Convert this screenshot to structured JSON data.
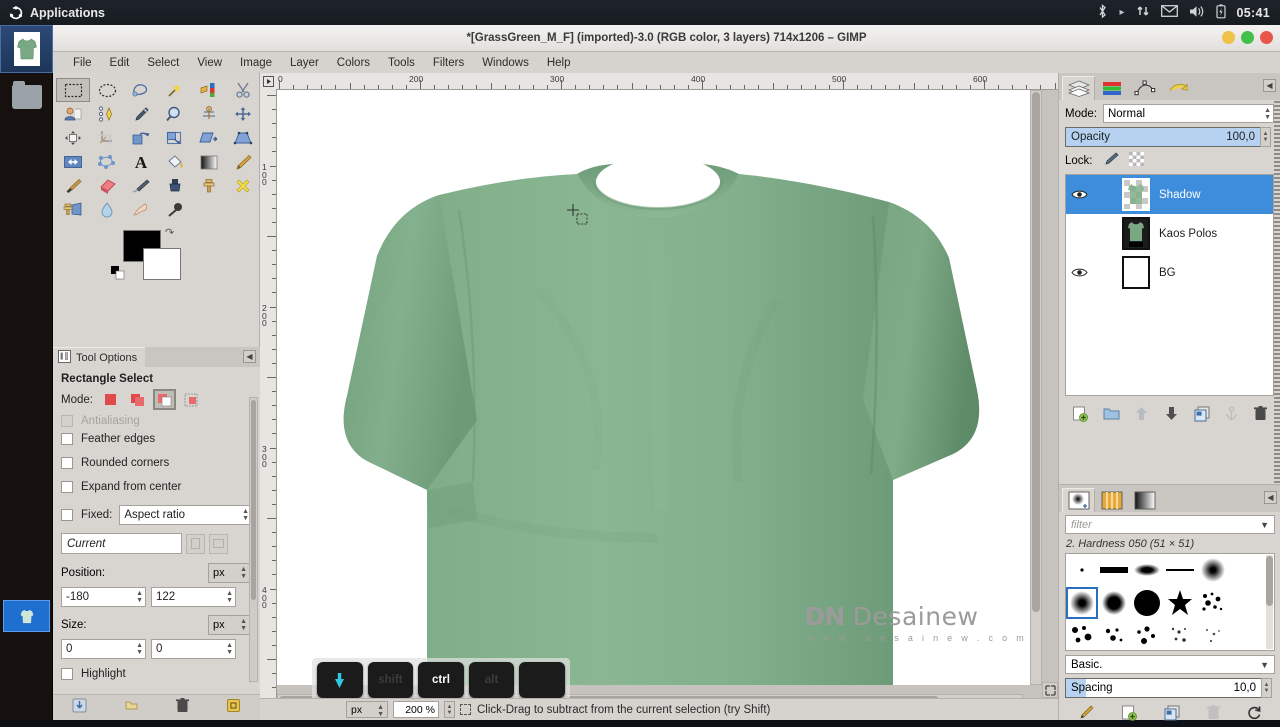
{
  "systembar": {
    "applications_label": "Applications",
    "logo_icon": "ubuntu-logo-icon",
    "tray": [
      {
        "name": "bluetooth-icon",
        "glyph": "ᛦ"
      },
      {
        "name": "dropbox-sync-icon",
        "glyph": "▸"
      },
      {
        "name": "network-updown-icon",
        "glyph": "⇅"
      },
      {
        "name": "mail-icon",
        "glyph": "✉"
      },
      {
        "name": "volume-icon",
        "glyph": "🔊"
      },
      {
        "name": "battery-icon",
        "glyph": "▯"
      }
    ],
    "clock": "05:41"
  },
  "launcher": {
    "items": [
      {
        "name": "launcher-gimp-item",
        "icon": "gimp-shirt-thumbnail",
        "selected": true
      },
      {
        "name": "launcher-files-item",
        "icon": "folder-icon",
        "selected": false
      }
    ],
    "taskbar_item": {
      "name": "launcher-window-preview",
      "icon": "shirt-window-preview"
    }
  },
  "window": {
    "title": "*[GrassGreen_M_F] (imported)-3.0 (RGB color, 3 layers) 714x1206 – GIMP",
    "buttons": [
      {
        "name": "minimize-button",
        "color": "#f0c24a"
      },
      {
        "name": "maximize-button",
        "color": "#43c04a"
      },
      {
        "name": "close-button",
        "color": "#e8554b"
      }
    ]
  },
  "menubar": {
    "items": [
      "File",
      "Edit",
      "Select",
      "View",
      "Image",
      "Layer",
      "Colors",
      "Tools",
      "Filters",
      "Windows",
      "Help"
    ]
  },
  "toolbox": {
    "tools": [
      {
        "name": "rectangle-select-tool",
        "selected": true
      },
      {
        "name": "ellipse-select-tool",
        "selected": false
      },
      {
        "name": "free-select-tool",
        "selected": false
      },
      {
        "name": "fuzzy-select-tool",
        "selected": false
      },
      {
        "name": "select-by-color-tool",
        "selected": false
      },
      {
        "name": "scissors-select-tool",
        "selected": false
      },
      {
        "name": "foreground-select-tool",
        "selected": false
      },
      {
        "name": "paths-tool",
        "selected": false
      },
      {
        "name": "color-picker-tool",
        "selected": false
      },
      {
        "name": "zoom-tool",
        "selected": false
      },
      {
        "name": "measure-tool",
        "selected": false
      },
      {
        "name": "move-tool",
        "selected": false
      },
      {
        "name": "align-tool",
        "selected": false
      },
      {
        "name": "crop-tool",
        "selected": false
      },
      {
        "name": "rotate-tool",
        "selected": false
      },
      {
        "name": "scale-tool",
        "selected": false
      },
      {
        "name": "shear-tool",
        "selected": false
      },
      {
        "name": "perspective-tool",
        "selected": false
      },
      {
        "name": "flip-tool",
        "selected": false
      },
      {
        "name": "cage-transform-tool",
        "selected": false
      },
      {
        "name": "text-tool",
        "selected": false
      },
      {
        "name": "bucket-fill-tool",
        "selected": false
      },
      {
        "name": "gradient-tool",
        "selected": false
      },
      {
        "name": "pencil-tool",
        "selected": false
      },
      {
        "name": "paintbrush-tool",
        "selected": false
      },
      {
        "name": "eraser-tool",
        "selected": false
      },
      {
        "name": "airbrush-tool",
        "selected": false
      },
      {
        "name": "ink-tool",
        "selected": false
      },
      {
        "name": "clone-tool",
        "selected": false
      },
      {
        "name": "heal-tool",
        "selected": false
      },
      {
        "name": "perspective-clone-tool",
        "selected": false
      },
      {
        "name": "blur-sharpen-tool",
        "selected": false
      },
      {
        "name": "smudge-tool",
        "selected": false
      },
      {
        "name": "dodge-burn-tool",
        "selected": false
      }
    ],
    "foreground_color": "#000000",
    "background_color": "#ffffff"
  },
  "tool_options": {
    "tab_label": "Tool Options",
    "title": "Rectangle Select",
    "mode_label": "Mode:",
    "modes": [
      {
        "name": "mode-replace",
        "selected": false
      },
      {
        "name": "mode-add",
        "selected": false
      },
      {
        "name": "mode-subtract",
        "selected": true
      },
      {
        "name": "mode-intersect",
        "selected": false
      }
    ],
    "checks": [
      {
        "label": "Antialiasing",
        "checked": true,
        "disabled": true,
        "name": "antialiasing-checkbox"
      },
      {
        "label": "Feather edges",
        "checked": false,
        "disabled": false,
        "name": "feather-edges-checkbox"
      },
      {
        "label": "Rounded corners",
        "checked": false,
        "disabled": false,
        "name": "rounded-corners-checkbox"
      },
      {
        "label": "Expand from center",
        "checked": false,
        "disabled": false,
        "name": "expand-from-center-checkbox"
      }
    ],
    "fixed_label": "Fixed:",
    "fixed_value": "Aspect ratio",
    "aspect_value": "Current",
    "position_label": "Position:",
    "position_unit": "px",
    "position_x": "-180",
    "position_y": "122",
    "size_label": "Size:",
    "size_unit": "px",
    "size_w": "0",
    "size_h": "0",
    "highlight_label": "Highlight",
    "highlight_checked": false,
    "bottom_buttons": [
      {
        "name": "save-tool-preset-button"
      },
      {
        "name": "restore-tool-preset-button"
      },
      {
        "name": "delete-tool-preset-button"
      },
      {
        "name": "reset-tool-options-button"
      }
    ]
  },
  "canvas": {
    "ruler_h_labels": [
      "0",
      "200",
      "300",
      "400",
      "500",
      "600"
    ],
    "ruler_v_labels": [
      "100",
      "200",
      "300",
      "400"
    ],
    "watermark_title": "Desainew",
    "watermark_url": "w w w . d e s a i n e w . c o m",
    "watermark_mark": "DN"
  },
  "keys_overlay": {
    "keys": [
      {
        "label": "",
        "name": "key-cursor",
        "style": "cursor"
      },
      {
        "label": "shift",
        "name": "key-shift",
        "style": "ghost"
      },
      {
        "label": "ctrl",
        "name": "key-ctrl",
        "style": "active"
      },
      {
        "label": "alt",
        "name": "key-alt",
        "style": "ghost"
      },
      {
        "label": "",
        "name": "key-blank",
        "style": "ghost"
      }
    ]
  },
  "statusbar": {
    "unit": "px",
    "zoom": "200 %",
    "message": "Click-Drag to subtract from the current selection (try Shift)"
  },
  "layers_dock": {
    "tabs": [
      {
        "name": "tab-layers",
        "selected": true
      },
      {
        "name": "tab-channels",
        "selected": false
      },
      {
        "name": "tab-paths",
        "selected": false
      },
      {
        "name": "tab-undo-history",
        "selected": false
      }
    ],
    "mode_label": "Mode:",
    "mode_value": "Normal",
    "opacity_label": "Opacity",
    "opacity_value": "100,0",
    "lock_label": "Lock:",
    "lock_buttons": [
      {
        "name": "lock-pixels-button"
      },
      {
        "name": "lock-alpha-button"
      }
    ],
    "layers": [
      {
        "name": "Shadow",
        "visible": true,
        "selected": true,
        "thumb": "checker-shirt"
      },
      {
        "name": "Kaos Polos",
        "visible": false,
        "selected": false,
        "thumb": "dark-shirt"
      },
      {
        "name": "BG",
        "visible": true,
        "selected": false,
        "thumb": "white"
      }
    ],
    "bottom_buttons": [
      {
        "name": "new-layer-button"
      },
      {
        "name": "new-layer-group-button"
      },
      {
        "name": "raise-layer-button"
      },
      {
        "name": "lower-layer-button"
      },
      {
        "name": "duplicate-layer-button"
      },
      {
        "name": "anchor-layer-button"
      },
      {
        "name": "delete-layer-button"
      }
    ]
  },
  "brushes_dock": {
    "tabs": [
      {
        "name": "tab-brushes",
        "selected": true
      },
      {
        "name": "tab-patterns",
        "selected": false
      },
      {
        "name": "tab-gradients",
        "selected": false
      }
    ],
    "filter_placeholder": "filter",
    "selected_brush": "2. Hardness 050 (51 × 51)",
    "basic_value": "Basic.",
    "spacing_label": "Spacing",
    "spacing_value": "10,0",
    "bottom_buttons": [
      {
        "name": "edit-brush-button"
      },
      {
        "name": "new-brush-button"
      },
      {
        "name": "duplicate-brush-button"
      },
      {
        "name": "delete-brush-button"
      },
      {
        "name": "refresh-brushes-button"
      }
    ]
  },
  "colors": {
    "accent": "#3e8ddd",
    "panel_bg": "#d8d5d1",
    "shirt_green": "#7fae87"
  }
}
